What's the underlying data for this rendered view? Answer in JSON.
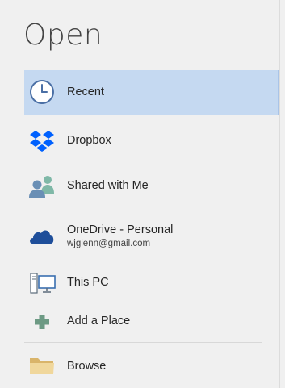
{
  "page": {
    "title": "Open"
  },
  "places": [
    {
      "label": "Recent",
      "icon": "clock-icon",
      "selected": true
    },
    {
      "label": "Dropbox",
      "icon": "dropbox-icon"
    },
    {
      "label": "Shared with Me",
      "icon": "people-icon"
    },
    {
      "label": "OneDrive - Personal",
      "sublabel": "wjglenn@gmail.com",
      "icon": "cloud-icon"
    },
    {
      "label": "This PC",
      "icon": "computer-icon"
    },
    {
      "label": "Add a Place",
      "icon": "plus-icon"
    },
    {
      "label": "Browse",
      "icon": "folder-icon"
    }
  ],
  "colors": {
    "selected_bg": "#c5d9f1",
    "dropbox_blue": "#0061fe",
    "onedrive_blue": "#1e4e9a",
    "plus_green": "#6d9a84",
    "folder_tan": "#e8c88a"
  }
}
